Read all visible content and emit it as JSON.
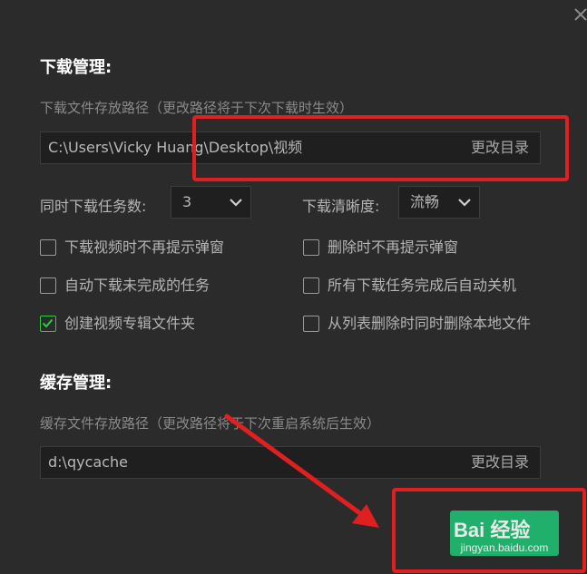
{
  "download": {
    "section_title": "下载管理:",
    "path_hint": "下载文件存放路径（更改路径将于下次下载时生效）",
    "path_value": "C:\\Users\\Vicky Huang\\Desktop\\视频",
    "change_dir_label": "更改目录",
    "concurrent_label": "同时下载任务数:",
    "concurrent_value": "3",
    "quality_label": "下载清晰度:",
    "quality_value": "流畅",
    "options": [
      {
        "label": "下载视频时不再提示弹窗",
        "checked": false
      },
      {
        "label": "删除时不再提示弹窗",
        "checked": false
      },
      {
        "label": "自动下载未完成的任务",
        "checked": false
      },
      {
        "label": "所有下载任务完成后自动关机",
        "checked": false
      },
      {
        "label": "创建视频专辑文件夹",
        "checked": true
      },
      {
        "label": "从列表删除时同时删除本地文件",
        "checked": false
      }
    ]
  },
  "cache": {
    "section_title": "缓存管理:",
    "path_hint": "缓存文件存放路径（更改路径将于下次重启系统后生效）",
    "path_value": "d:\\qycache",
    "change_dir_label": "更改目录"
  },
  "watermark": {
    "logo": "Bai 经验",
    "url": "jingyan.baidu.com"
  },
  "colors": {
    "background": "#2b2b2b",
    "checked_accent": "#2ecc40",
    "annotation_red": "#e02020"
  },
  "icons": {
    "close": "close-icon",
    "dropdown": "chevron-down-icon",
    "check": "checkmark-icon"
  }
}
